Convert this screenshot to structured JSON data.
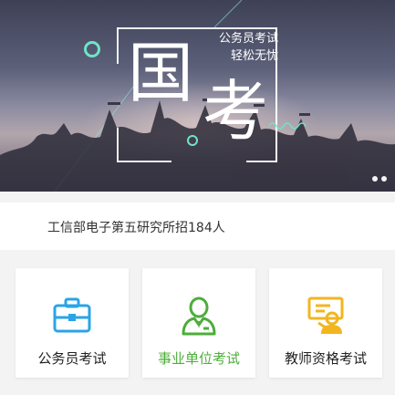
{
  "banner": {
    "title_char_1": "国",
    "title_char_2": "考",
    "slogan_line_1": "公务员考试",
    "slogan_line_2": "轻松无忧",
    "carousel_dots": 2,
    "active_dot": 1
  },
  "news": {
    "text": "工信部电子第五研究所招184人"
  },
  "categories": [
    {
      "label": "公务员考试",
      "icon": "briefcase-icon",
      "color": "#2aa4e6"
    },
    {
      "label": "事业单位考试",
      "icon": "person-icon",
      "color": "#4cae3a"
    },
    {
      "label": "教师资格考试",
      "icon": "teacher-board-icon",
      "color": "#f3b51f"
    }
  ],
  "colors": {
    "accent_ring": "#6fe3c8",
    "page_bg": "#f3f3f3",
    "highlight_label": "#4cae3a"
  }
}
